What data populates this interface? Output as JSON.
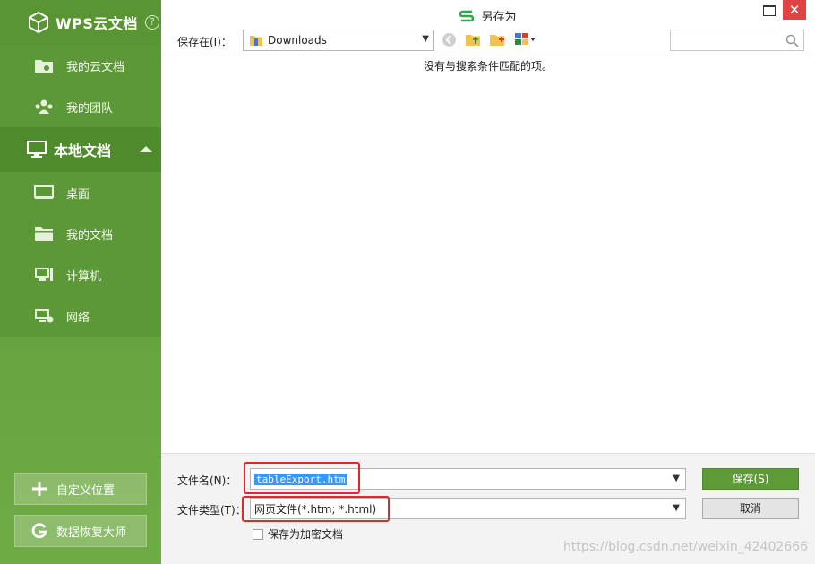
{
  "sidebar": {
    "brand": "WPS云文档",
    "help": "?",
    "cloud_items": [
      {
        "label": "我的云文档",
        "icon": "cloud-folder-icon"
      },
      {
        "label": "我的团队",
        "icon": "team-icon"
      }
    ],
    "local_section": {
      "label": "本地文档",
      "icon": "monitor-icon",
      "expanded": true
    },
    "local_items": [
      {
        "label": "桌面",
        "icon": "desktop-icon"
      },
      {
        "label": "我的文档",
        "icon": "folder-icon"
      },
      {
        "label": "计算机",
        "icon": "computer-icon"
      },
      {
        "label": "网络",
        "icon": "network-icon"
      }
    ],
    "custom_location": "自定义位置",
    "data_recovery": "数据恢复大师"
  },
  "window": {
    "title": "另存为",
    "close": "✕"
  },
  "toolbar": {
    "save_in_label": "保存在(I)：",
    "location": "Downloads",
    "search_placeholder": ""
  },
  "file_area": {
    "empty_message": "没有与搜索条件匹配的项。"
  },
  "bottom": {
    "filename_label": "文件名(N)：",
    "filename_value": "tableExport.htm",
    "filetype_label": "文件类型(T)：",
    "filetype_value": "网页文件(*.htm; *.html)",
    "save_button": "保存(S)",
    "cancel_button": "取消",
    "encrypt_checkbox": "保存为加密文档",
    "encrypt_checked": false,
    "watermark": "https://blog.csdn.net/weixin_42402666"
  },
  "colors": {
    "sidebar_green": "#66a23e",
    "save_green": "#5e9b37",
    "close_red": "#e04343",
    "highlight_red": "#e5252a",
    "selection_blue": "#3399ff"
  }
}
